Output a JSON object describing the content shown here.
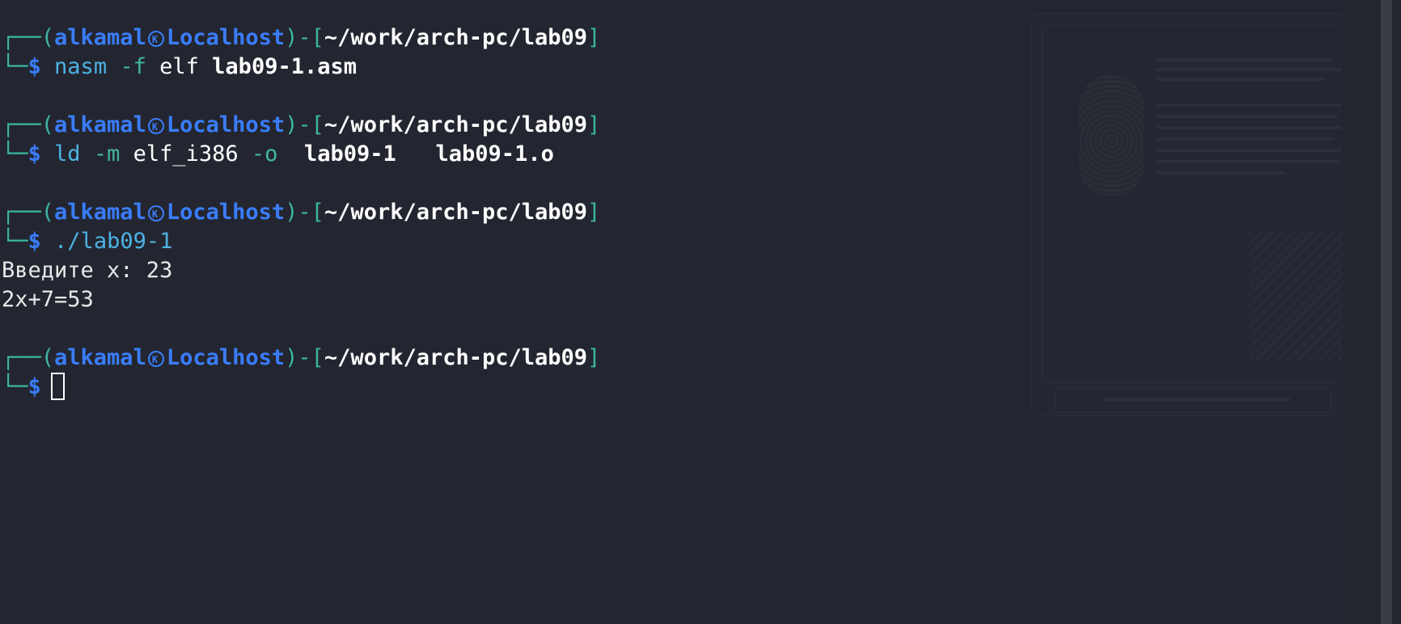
{
  "prompt": {
    "frame_top_left": "┌──(",
    "frame_mid": ")-[",
    "frame_close": "]",
    "frame_bottom": "└─",
    "dollar": "$",
    "user": "alkamal",
    "host": "Localhost",
    "path": "~/work/arch-pc/lab09",
    "icon": "kali-icon"
  },
  "commands": [
    {
      "cmd": "nasm",
      "flag1": "-f",
      "arg1": "elf",
      "arg2": "lab09-1.asm"
    },
    {
      "cmd": "ld",
      "flag1": "-m",
      "arg1": "elf_i386",
      "flag2": "-o",
      "arg2": "lab09-1",
      "arg3": "lab09-1.o"
    },
    {
      "cmd": "./lab09-1",
      "output": [
        "Введите x: 23",
        "2x+7=53"
      ]
    }
  ],
  "colors": {
    "background": "#232630",
    "frame": "#3bb6a2",
    "user_host": "#3a7dfb",
    "command": "#4db3e6",
    "text": "#ffffff"
  }
}
